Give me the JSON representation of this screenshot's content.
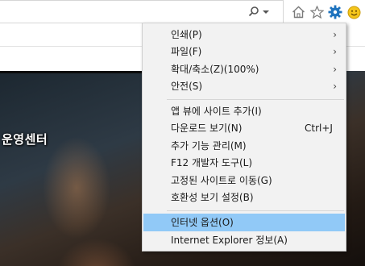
{
  "colors": {
    "menu_bg": "#f2f2f2",
    "highlight": "#91c9f7",
    "gear_blue": "#1e73be",
    "smiley": "#f4c51c"
  },
  "toolbar": {
    "search_icon": "search-icon",
    "dropdown_icon": "chevron-down-icon",
    "home_icon": "home-icon",
    "favorites_icon": "star-icon",
    "tools_icon": "gear-icon",
    "feedback_icon": "smiley-icon"
  },
  "page": {
    "caption": "운영센터"
  },
  "menu": {
    "items": [
      {
        "label": "인쇄(P)",
        "has_submenu": true
      },
      {
        "label": "파일(F)",
        "has_submenu": true
      },
      {
        "label": "확대/축소(Z)(100%)",
        "has_submenu": true
      },
      {
        "label": "안전(S)",
        "has_submenu": true
      },
      {
        "label": "앱 뷰에 사이트 추가(I)"
      },
      {
        "label": "다운로드 보기(N)",
        "shortcut": "Ctrl+J"
      },
      {
        "label": "추가 기능 관리(M)"
      },
      {
        "label": "F12 개발자 도구(L)"
      },
      {
        "label": "고정된 사이트로 이동(G)"
      },
      {
        "label": "호환성 보기 설정(B)"
      },
      {
        "label": "인터넷 옵션(O)",
        "highlighted": true
      },
      {
        "label": "Internet Explorer 정보(A)"
      }
    ]
  }
}
